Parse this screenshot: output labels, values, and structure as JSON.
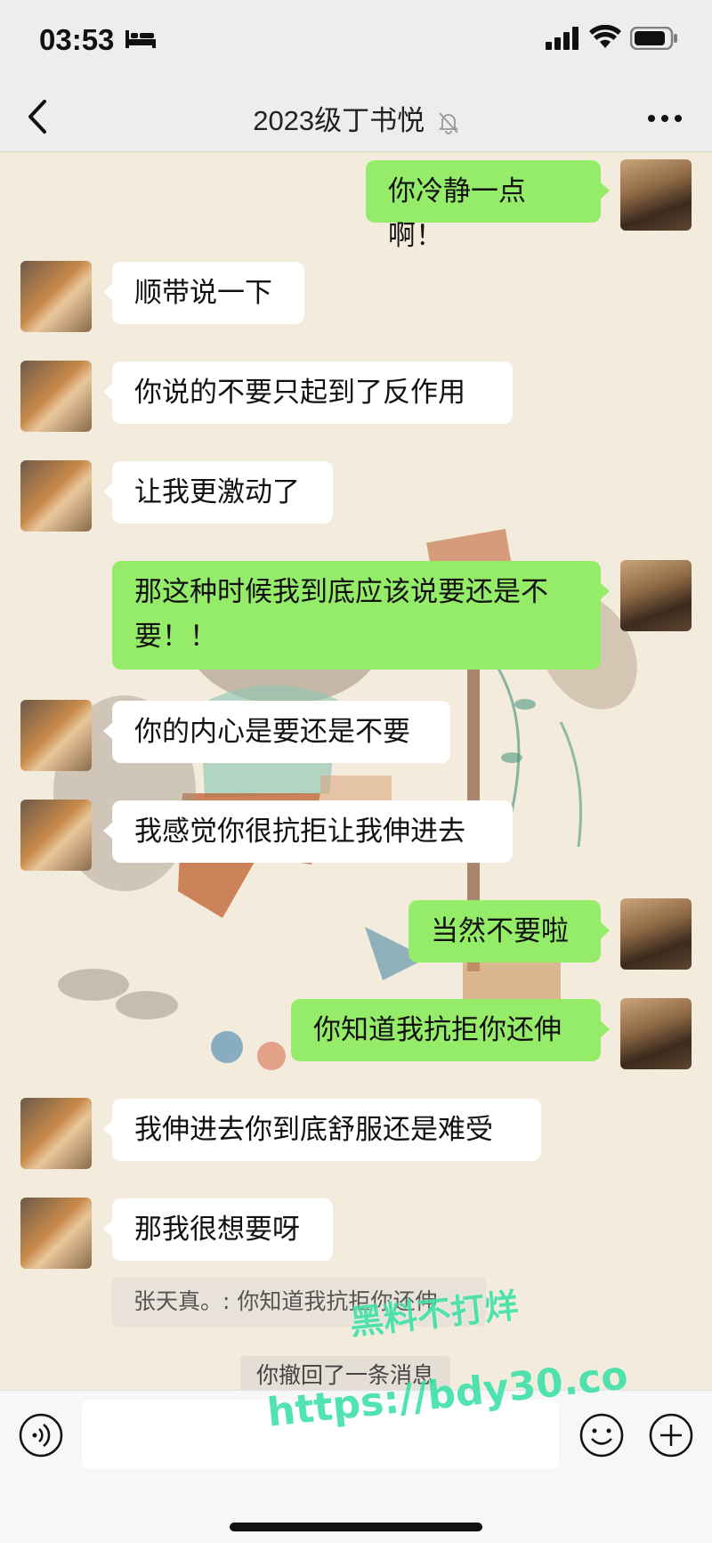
{
  "status_bar": {
    "time": "03:53",
    "icons": [
      "bed-icon",
      "signal-icon",
      "wifi-icon",
      "battery-icon"
    ]
  },
  "nav": {
    "title": "2023级丁书悦",
    "back_icon": "chevron-left-icon",
    "mute_icon": "bell-off-icon",
    "more_icon": "more-icon"
  },
  "messages": [
    {
      "side": "right",
      "text": "你冷静一点啊！"
    },
    {
      "side": "left",
      "text": "顺带说一下"
    },
    {
      "side": "left",
      "text": "你说的不要只起到了反作用"
    },
    {
      "side": "left",
      "text": "让我更激动了"
    },
    {
      "side": "right",
      "line1": "那这种时候我到底应该说要还是不",
      "line2": "要！！"
    },
    {
      "side": "left",
      "text": "你的内心是要还是不要"
    },
    {
      "side": "left",
      "text": "我感觉你很抗拒让我伸进去"
    },
    {
      "side": "right",
      "text": "当然不要啦"
    },
    {
      "side": "right",
      "text": "你知道我抗拒你还伸"
    },
    {
      "side": "left",
      "text": "我伸进去你到底舒服还是难受"
    },
    {
      "side": "left",
      "text": "那我很想要呀"
    }
  ],
  "quote": "张天真。: 你知道我抗拒你还伸",
  "system_message": "你撤回了一条消息",
  "watermark": {
    "line1": "黑料不打烊",
    "line2": "https://bdy30.co"
  },
  "input_bar": {
    "icons": [
      "voice-icon",
      "emoji-icon",
      "plus-icon"
    ]
  }
}
